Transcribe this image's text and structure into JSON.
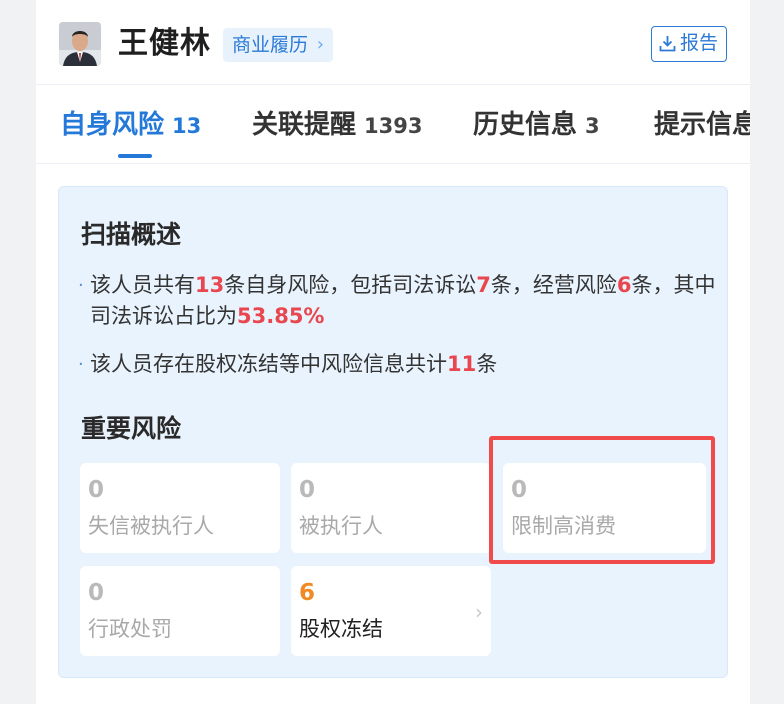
{
  "person": {
    "name": "王健林",
    "resume_tag": "商业履历",
    "report_label": "报告"
  },
  "tabs": [
    {
      "label": "自身风险",
      "count": "13",
      "active": true
    },
    {
      "label": "关联提醒",
      "count": "1393",
      "active": false
    },
    {
      "label": "历史信息",
      "count": "3",
      "active": false
    },
    {
      "label": "提示信息",
      "count": "",
      "active": false
    }
  ],
  "scan": {
    "title": "扫描概述",
    "line1": {
      "p1": "该人员共有",
      "total": "13",
      "p2": "条自身风险，包括司法诉讼",
      "judicial": "7",
      "p3": "条，经营风险",
      "business": "6",
      "p4": "条，其中司法诉讼占比为",
      "ratio": "53.85%"
    },
    "line2": {
      "p1": "该人员存在股权冻结等中风险信息共计",
      "count": "11",
      "p2": "条"
    }
  },
  "important": {
    "title": "重要风险",
    "tiles": [
      {
        "value": "0",
        "label": "失信被执行人"
      },
      {
        "value": "0",
        "label": "被执行人"
      },
      {
        "value": "0",
        "label": "限制高消费"
      },
      {
        "value": "0",
        "label": "行政处罚"
      },
      {
        "value": "6",
        "label": "股权冻结"
      }
    ]
  },
  "colors": {
    "accent": "#2378d8",
    "risk_red": "#e8474f",
    "orange": "#f08a24",
    "highlight": "#f04a4a"
  }
}
